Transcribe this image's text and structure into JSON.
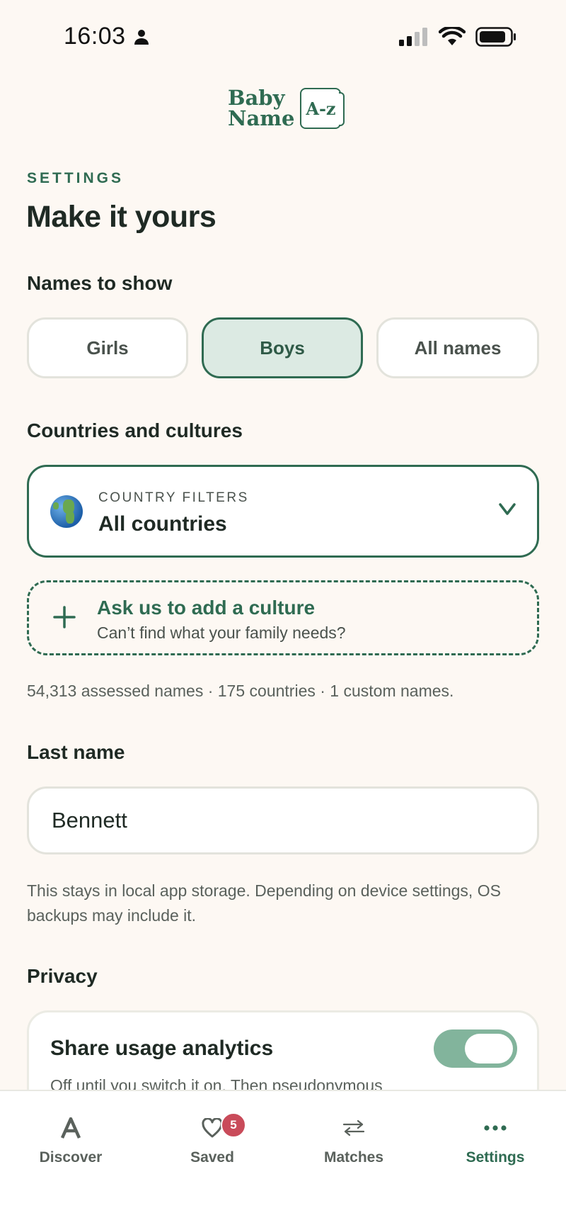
{
  "status_bar": {
    "time": "16:03"
  },
  "logo": {
    "line1": "Baby",
    "line2": "Name",
    "mark": "A-z"
  },
  "header": {
    "eyebrow": "SETTINGS",
    "title": "Make it yours"
  },
  "names_to_show": {
    "title": "Names to show",
    "options": [
      "Girls",
      "Boys",
      "All names"
    ],
    "selected": "Boys"
  },
  "countries": {
    "title": "Countries and cultures",
    "filter_label": "COUNTRY FILTERS",
    "filter_value": "All countries",
    "add_culture_title": "Ask us to add a culture",
    "add_culture_subtitle": "Can’t find what your family needs?",
    "stats": "54,313 assessed names · 175 countries · 1 custom names."
  },
  "last_name": {
    "title": "Last name",
    "value": "Bennett",
    "hint": "This stays in local app storage. Depending on device settings, OS backups may include it."
  },
  "privacy": {
    "title": "Privacy",
    "analytics_title": "Share usage analytics",
    "analytics_subtitle": "Off until you switch it on. Then pseudonymous"
  },
  "nav": {
    "items": [
      {
        "label": "Discover",
        "icon": "letter-a-icon"
      },
      {
        "label": "Saved",
        "icon": "heart-icon",
        "badge": "5"
      },
      {
        "label": "Matches",
        "icon": "swap-arrows-icon"
      },
      {
        "label": "Settings",
        "icon": "more-dots-icon"
      }
    ],
    "active": "Settings"
  },
  "colors": {
    "accent": "#2f6b52",
    "background": "#fdf8f3",
    "badge": "#c94b5a"
  }
}
